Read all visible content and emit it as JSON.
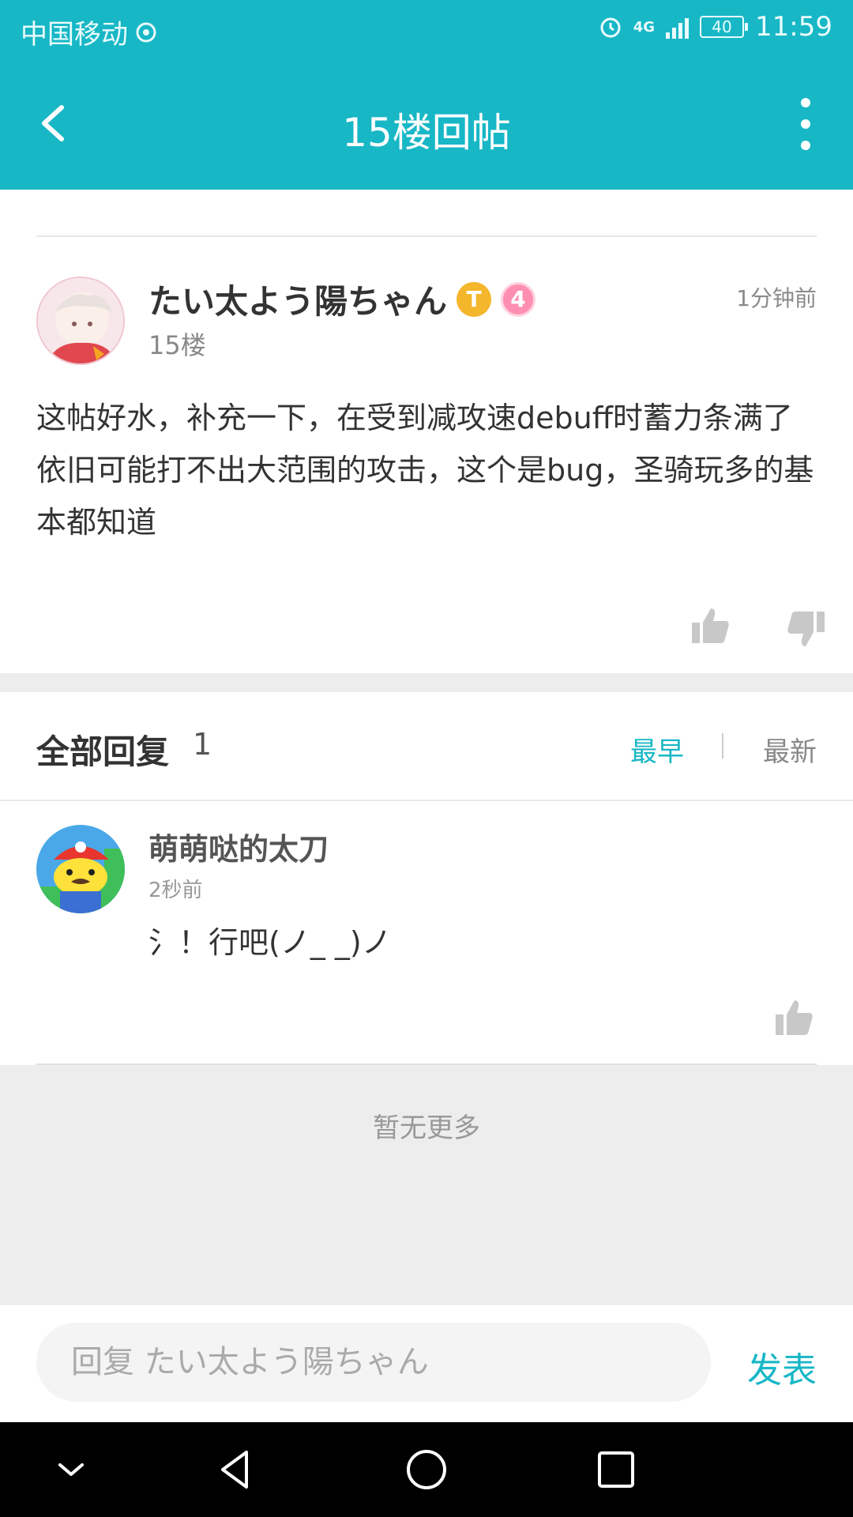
{
  "status_bar": {
    "carrier": "中国移动",
    "network": "4G",
    "battery": "40",
    "time": "11:59"
  },
  "app_bar": {
    "title": "15楼回帖",
    "back_icon": "back-arrow-icon",
    "more_icon": "more-vertical-icon"
  },
  "post": {
    "author": "たい太よう陽ちゃん",
    "badge_t": "T",
    "level": "4",
    "floor": "15楼",
    "time": "1分钟前",
    "content": "这帖好水，补充一下，在受到减攻速debuff时蓄力条满了依旧可能打不出大范围的攻击，这个是bug，圣骑玩多的基本都知道"
  },
  "replies": {
    "label": "全部回复",
    "count": "1",
    "sort_earliest": "最早",
    "sort_latest": "最新",
    "items": [
      {
        "author": "萌萌哒的太刀",
        "time": "2秒前",
        "text": "氵！行吧(ノ_ _)ノ"
      }
    ],
    "no_more": "暂无更多"
  },
  "composer": {
    "placeholder": "回复 たい太よう陽ちゃん",
    "send_label": "发表"
  },
  "colors": {
    "accent": "#17b7c6",
    "background_gray": "#ededed"
  }
}
